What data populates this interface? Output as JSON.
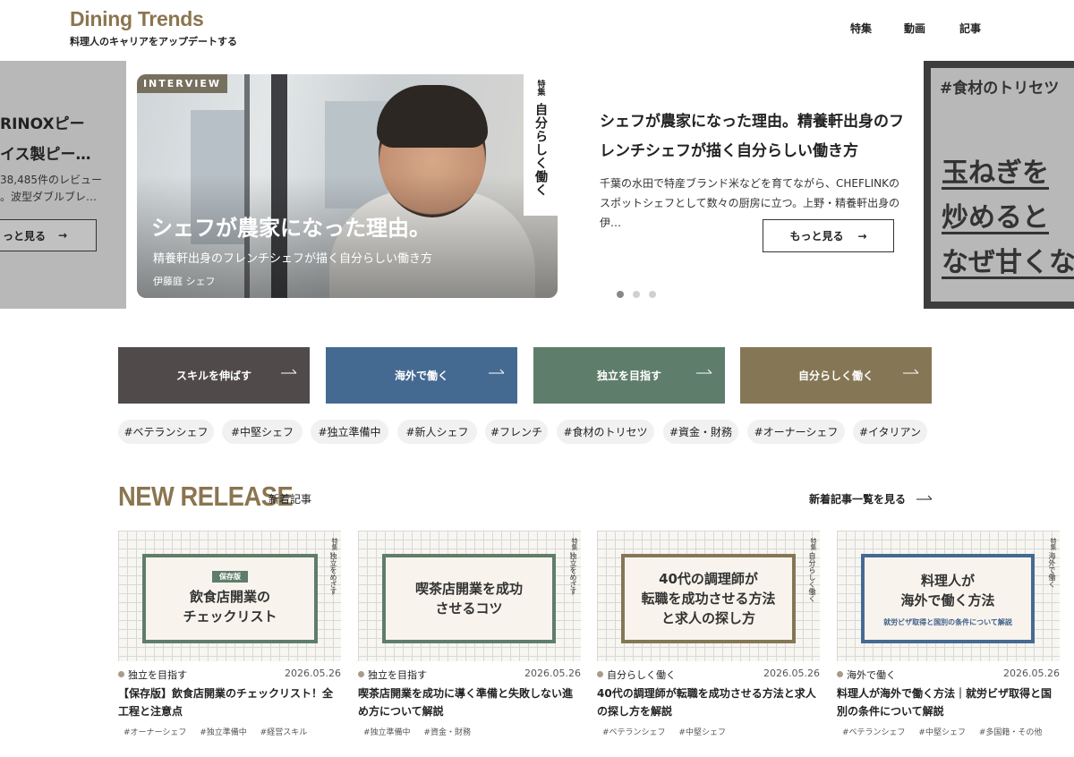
{
  "header": {
    "logo": "Dining Trends",
    "tagline": "料理人のキャリアをアップデートする",
    "nav": [
      "特集",
      "動画",
      "記事"
    ]
  },
  "hero": {
    "left_slide": {
      "title_lines": [
        "RINOXピー",
        "イス製ピー…"
      ],
      "desc_lines": [
        "38,485件のレビュー",
        "。波型ダブルブレ…"
      ],
      "button": "っと見る"
    },
    "badge": "INTERVIEW",
    "vertical_small": "特集",
    "vertical_big": "自分らしく働く",
    "image_title": "シェフが農家になった理由。",
    "image_subtitle": "精養軒出身のフレンチシェフが描く自分らしい働き方",
    "image_name": "伊藤庭 シェフ",
    "title": "シェフが農家になった理由。精養軒出身のフレンチシェフが描く自分らしい働き方",
    "description": "千葉の水田で特産ブランド米などを育てながら、CHEFLINKのスポットシェフとして数々の厨房に立つ。上野・精養軒出身の伊…",
    "button": "もっと見る",
    "right_slide": {
      "hashtag": "#食材のトリセツ",
      "big_lines": [
        "玉ねぎを",
        "炒めると",
        "なぜ甘くな"
      ]
    }
  },
  "categories": [
    {
      "label": "スキルを伸ばす",
      "color": "#504a4a"
    },
    {
      "label": "海外で働く",
      "color": "#456a92"
    },
    {
      "label": "独立を目指す",
      "color": "#5e7d6a"
    },
    {
      "label": "自分らしく働く",
      "color": "#857756"
    }
  ],
  "tags": [
    "#ベテランシェフ",
    "#中堅シェフ",
    "#独立準備中",
    "#新人シェフ",
    "#フレンチ",
    "#食材のトリセツ",
    "#資金・財務",
    "#オーナーシェフ",
    "#イタリアン"
  ],
  "new_release": {
    "title": "NEW RELEASE",
    "subtitle": "新着記事",
    "link": "新着記事一覧を見る"
  },
  "cards": [
    {
      "thumb_badge": "保存版",
      "thumb_lines": [
        "飲食店開業の",
        "チェックリスト"
      ],
      "thumb_note": "",
      "vertical_small": "特集",
      "vertical": "独立をめざす",
      "border": "#5e7d6a",
      "category": "独立を目指す",
      "date": "2026.05.26",
      "title": "【保存版】飲食店開業のチェックリスト！全工程と注意点",
      "tags": [
        "#オーナーシェフ",
        "#独立準備中",
        "#経営スキル"
      ]
    },
    {
      "thumb_badge": "",
      "thumb_lines": [
        "喫茶店開業を成功",
        "させるコツ"
      ],
      "thumb_note": "",
      "vertical_small": "特集",
      "vertical": "独立をめざす",
      "border": "#5e7d6a",
      "category": "独立を目指す",
      "date": "2026.05.26",
      "title": "喫茶店開業を成功に導く準備と失敗しない進め方について解説",
      "tags": [
        "#独立準備中",
        "#資金・財務"
      ]
    },
    {
      "thumb_badge": "",
      "thumb_lines": [
        "40代の調理師が",
        "転職を成功させる方法",
        "と求人の探し方"
      ],
      "thumb_note": "",
      "vertical_small": "特集",
      "vertical": "自分らしく働く",
      "border": "#857756",
      "category": "自分らしく働く",
      "date": "2026.05.26",
      "title": "40代の調理師が転職を成功させる方法と求人の探し方を解説",
      "tags": [
        "#ベテランシェフ",
        "#中堅シェフ"
      ]
    },
    {
      "thumb_badge": "",
      "thumb_lines": [
        "料理人が",
        "海外で働く方法"
      ],
      "thumb_note": "就労ビザ取得と国別の条件について解説",
      "vertical_small": "特集",
      "vertical": "海外で働く",
      "border": "#456a92",
      "category": "海外で働く",
      "date": "2026.05.26",
      "title": "料理人が海外で働く方法｜就労ビザ取得と国別の条件について解説",
      "tags": [
        "#ベテランシェフ",
        "#中堅シェフ",
        "#多国籍・その他"
      ]
    }
  ]
}
